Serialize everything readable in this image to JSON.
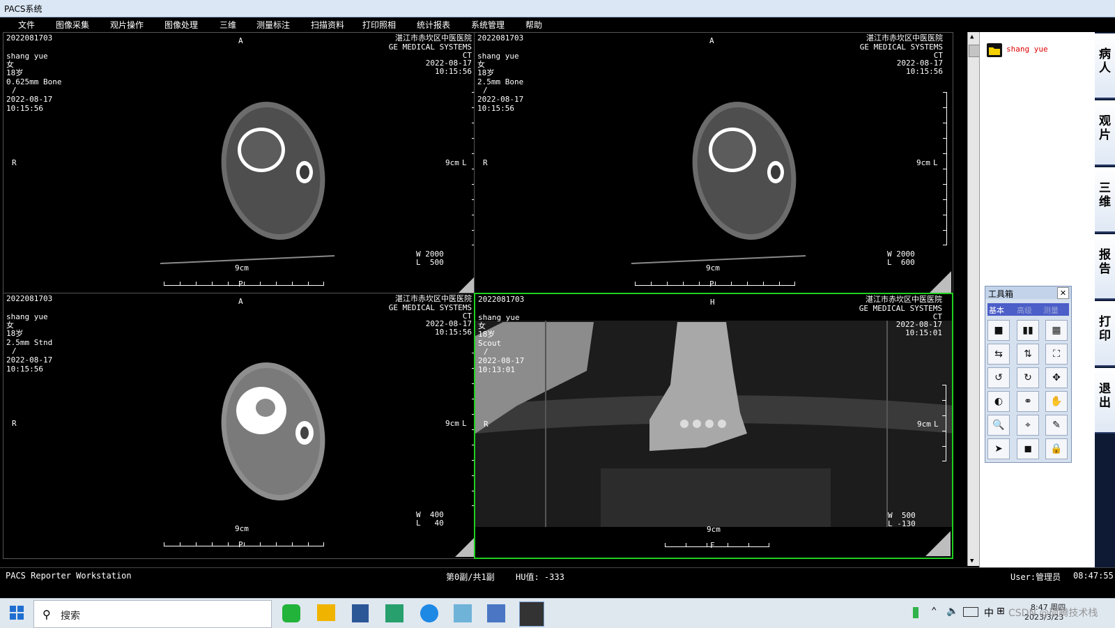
{
  "window": {
    "title": "PACS系统"
  },
  "menu": [
    "文件",
    "图像采集",
    "观片操作",
    "图像处理",
    "三维",
    "测量标注",
    "扫描资料",
    "打印照相",
    "统计报表",
    "系统管理",
    "帮助"
  ],
  "viewports": [
    {
      "id": "2022081703",
      "orient_top": "A",
      "orient_left": "R",
      "orient_bottom": "P",
      "hospital": "湛江市赤坎区中医医院",
      "maker": "GE MEDICAL SYSTEMS",
      "modality": "CT",
      "date": "2022-08-17",
      "time": "10:15:56",
      "patient": "shang yue",
      "sex": "女",
      "age": "18岁",
      "series": "0.625mm Bone",
      "slash": "/",
      "date2": "2022-08-17",
      "time2": "10:15:56",
      "scale_v": "9cm",
      "scale_h": "9cm",
      "scale_l": "L",
      "window": "W 2000",
      "level": "L  500"
    },
    {
      "id": "2022081703",
      "orient_top": "A",
      "orient_left": "R",
      "orient_bottom": "P",
      "hospital": "湛江市赤坎区中医医院",
      "maker": "GE MEDICAL SYSTEMS",
      "modality": "CT",
      "date": "2022-08-17",
      "time": "10:15:56",
      "patient": "shang yue",
      "sex": "女",
      "age": "18岁",
      "series": "2.5mm Bone",
      "slash": "/",
      "date2": "2022-08-17",
      "time2": "10:15:56",
      "scale_v": "9cm",
      "scale_h": "9cm",
      "scale_l": "L",
      "window": "W 2000",
      "level": "L  600"
    },
    {
      "id": "2022081703",
      "orient_top": "A",
      "orient_left": "R",
      "orient_bottom": "P",
      "hospital": "湛江市赤坎区中医医院",
      "maker": "GE MEDICAL SYSTEMS",
      "modality": "CT",
      "date": "2022-08-17",
      "time": "10:15:56",
      "patient": "shang yue",
      "sex": "女",
      "age": "18岁",
      "series": "2.5mm Stnd",
      "slash": "/",
      "date2": "2022-08-17",
      "time2": "10:15:56",
      "scale_v": "9cm",
      "scale_h": "9cm",
      "scale_l": "L",
      "window": "W  400",
      "level": "L   40"
    },
    {
      "id": "2022081703",
      "orient_top": "H",
      "orient_left": "R",
      "orient_bottom": "F",
      "hospital": "湛江市赤坎区中医医院",
      "maker": "GE MEDICAL SYSTEMS",
      "modality": "CT",
      "date": "2022-08-17",
      "time": "10:15:01",
      "patient": "shang yue",
      "sex": "女",
      "age": "18岁",
      "series": "Scout",
      "slash": "/",
      "date2": "2022-08-17",
      "time2": "10:13:01",
      "scale_v": "9cm",
      "scale_h": "9cm",
      "scale_l": "L",
      "window": "W  500",
      "level": "L -130"
    }
  ],
  "sidebar": {
    "patient_name": "shang yue"
  },
  "side_tabs": [
    "病人",
    "观片",
    "三维",
    "报告",
    "打印",
    "退出"
  ],
  "toolbox": {
    "title": "工具箱",
    "close_glyph": "✕",
    "tabs": [
      "基本",
      "高级",
      "测量"
    ],
    "buttons": [
      {
        "icon": "layout-1x1-icon",
        "glyph": "■"
      },
      {
        "icon": "layout-1x2-icon",
        "glyph": "▮▮"
      },
      {
        "icon": "layout-2x2-icon",
        "glyph": "▦"
      },
      {
        "icon": "flip-horizontal-icon",
        "glyph": "⇆"
      },
      {
        "icon": "flip-vertical-icon",
        "glyph": "⇅"
      },
      {
        "icon": "fit-window-icon",
        "glyph": "⛶"
      },
      {
        "icon": "rotate-left-icon",
        "glyph": "↺"
      },
      {
        "icon": "rotate-right-icon",
        "glyph": "↻"
      },
      {
        "icon": "move-icon",
        "glyph": "✥"
      },
      {
        "icon": "window-level-icon",
        "glyph": "◐"
      },
      {
        "icon": "link-icon",
        "glyph": "⚭"
      },
      {
        "icon": "pan-hand-icon",
        "glyph": "✋"
      },
      {
        "icon": "zoom-icon",
        "glyph": "🔍"
      },
      {
        "icon": "magnify-region-icon",
        "glyph": "⌖"
      },
      {
        "icon": "annotate-icon",
        "glyph": "✎"
      },
      {
        "icon": "pointer-icon",
        "glyph": "➤"
      },
      {
        "icon": "reset-icon",
        "glyph": "◼"
      },
      {
        "icon": "lock-icon",
        "glyph": "🔒"
      }
    ]
  },
  "status": {
    "app": "PACS Reporter Workstation",
    "page": "第0副/共1副",
    "hu": "HU值: -333",
    "user": "User:管理员",
    "clock": "08:47:55"
  },
  "taskbar": {
    "search_placeholder": "搜索",
    "time": "8:47 周四",
    "date": "2023/3/23",
    "ime": "中",
    "ime2": "⊞",
    "watermark": "CSDN @硕腾技术栈"
  }
}
